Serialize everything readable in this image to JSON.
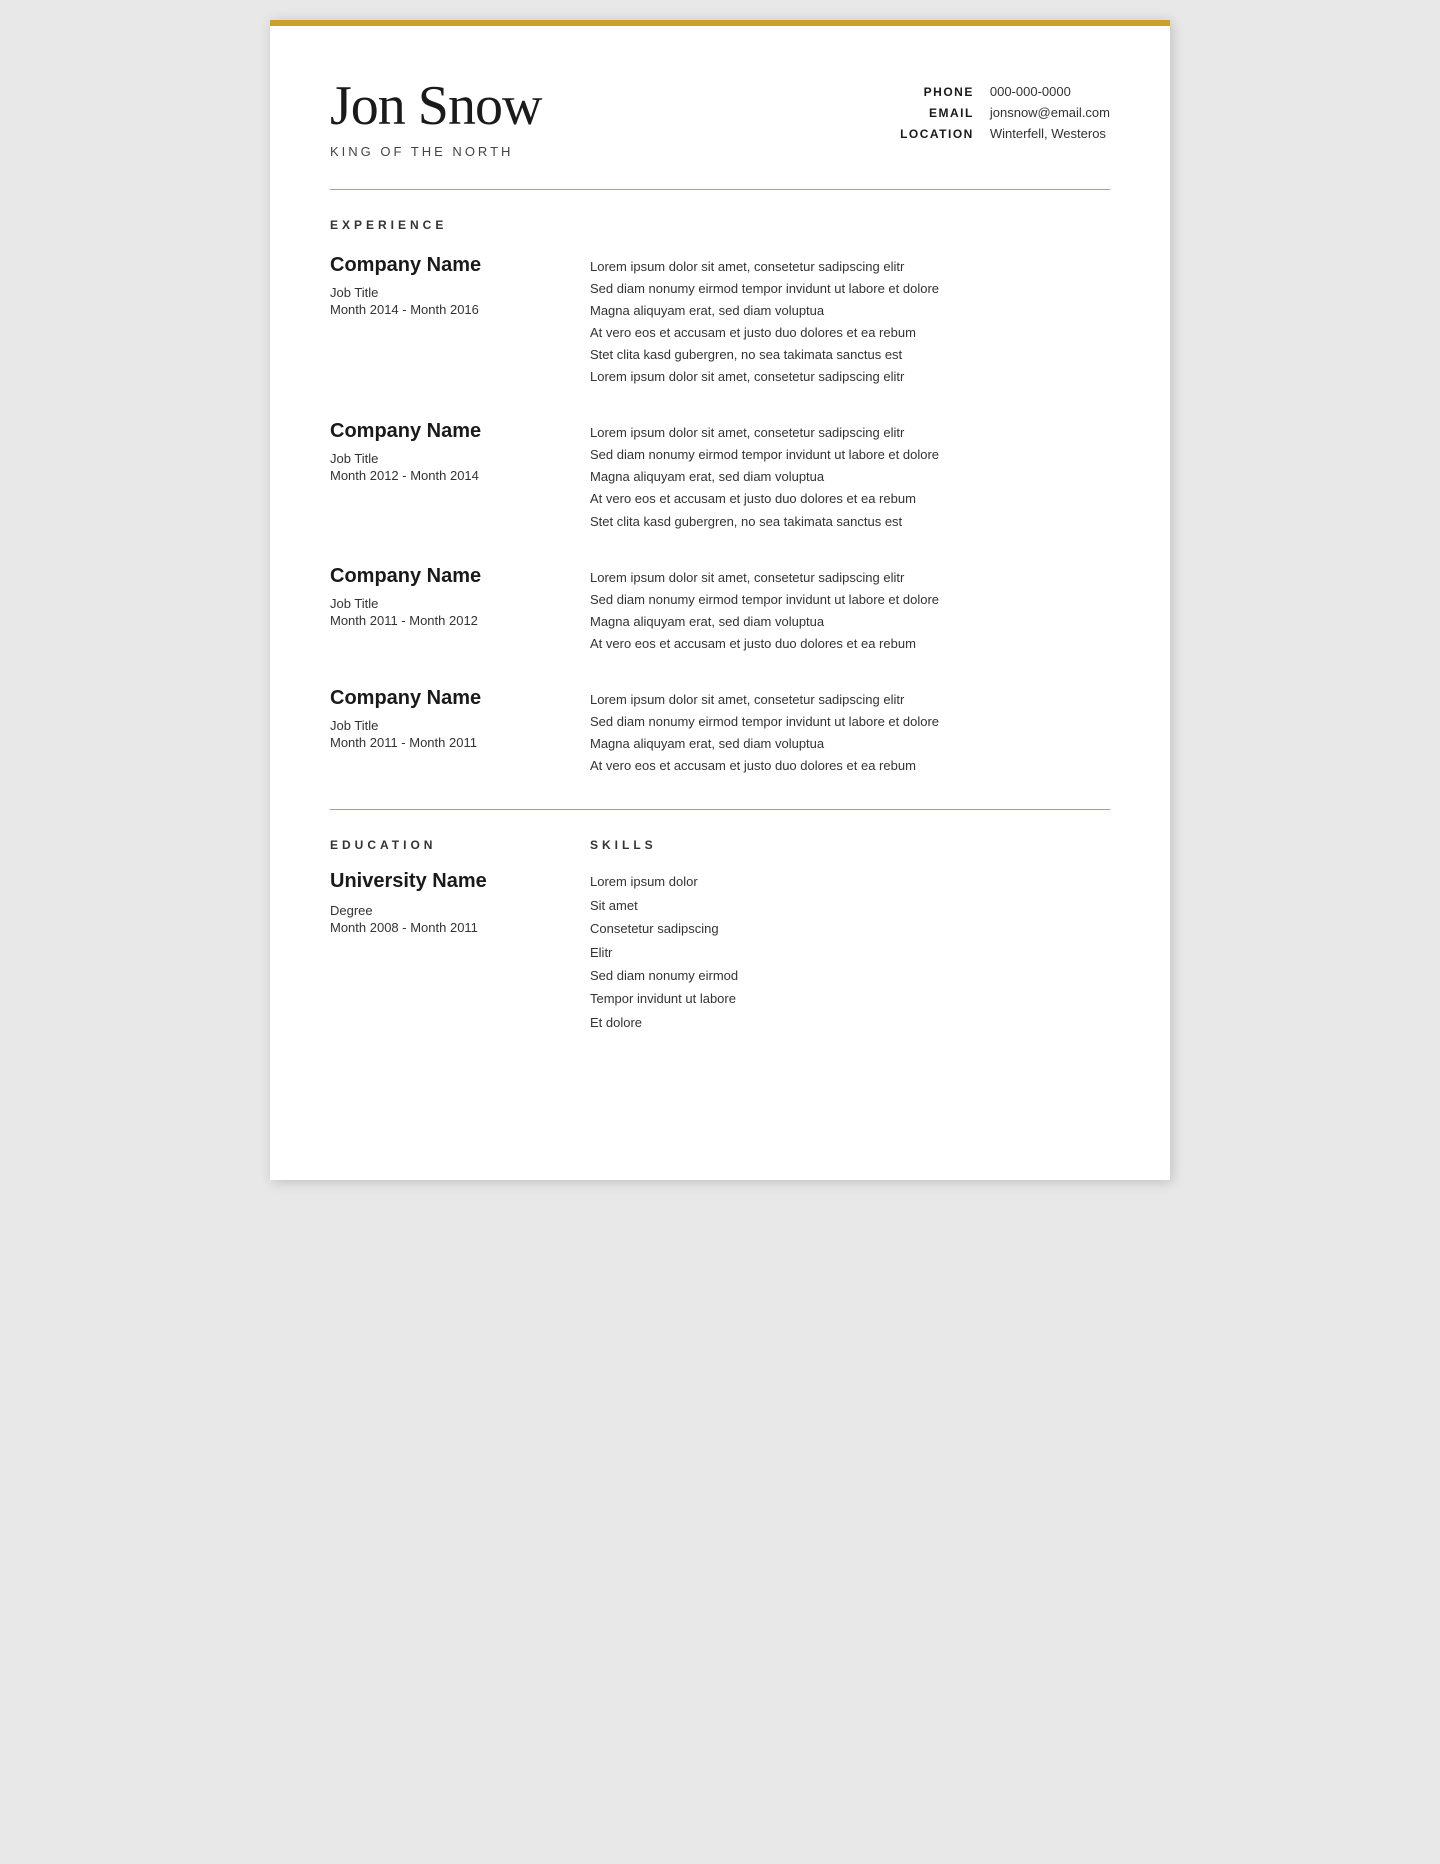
{
  "header": {
    "name": "Jon Snow",
    "tagline": "KING OF THE NORTH",
    "contact": {
      "phone_label": "PHONE",
      "phone_value": "000-000-0000",
      "email_label": "EMAIL",
      "email_value": "jonsnow@email.com",
      "location_label": "LOCATION",
      "location_value": "Winterfell, Westeros"
    }
  },
  "sections": {
    "experience_label": "EXPERIENCE",
    "education_label": "EDUCATION",
    "skills_label": "SKILLS"
  },
  "experience": [
    {
      "company": "Company Name",
      "title": "Job Title",
      "dates": "Month 2014 - Month 2016",
      "description": [
        "Lorem ipsum dolor sit amet, consetetur sadipscing elitr",
        "Sed diam nonumy eirmod tempor invidunt ut labore et dolore",
        "Magna aliquyam erat, sed diam voluptua",
        "At vero eos et accusam et justo duo dolores et ea rebum",
        "Stet clita kasd gubergren, no sea takimata sanctus est",
        "Lorem ipsum dolor sit amet, consetetur sadipscing elitr"
      ]
    },
    {
      "company": "Company Name",
      "title": "Job Title",
      "dates": "Month 2012 - Month 2014",
      "description": [
        "Lorem ipsum dolor sit amet, consetetur sadipscing elitr",
        "Sed diam nonumy eirmod tempor invidunt ut labore et dolore",
        "Magna aliquyam erat, sed diam voluptua",
        "At vero eos et accusam et justo duo dolores et ea rebum",
        "Stet clita kasd gubergren, no sea takimata sanctus est"
      ]
    },
    {
      "company": "Company Name",
      "title": "Job Title",
      "dates": "Month 2011 - Month 2012",
      "description": [
        "Lorem ipsum dolor sit amet, consetetur sadipscing elitr",
        "Sed diam nonumy eirmod tempor invidunt ut labore et dolore",
        "Magna aliquyam erat, sed diam voluptua",
        "At vero eos et accusam et justo duo dolores et ea rebum"
      ]
    },
    {
      "company": "Company Name",
      "title": "Job Title",
      "dates": "Month 2011 - Month 2011",
      "description": [
        "Lorem ipsum dolor sit amet, consetetur sadipscing elitr",
        "Sed diam nonumy eirmod tempor invidunt ut labore et dolore",
        "Magna aliquyam erat, sed diam voluptua",
        "At vero eos et accusam et justo duo dolores et ea rebum"
      ]
    }
  ],
  "education": {
    "university": "University Name",
    "degree": "Degree",
    "dates": "Month 2008 - Month 2011"
  },
  "skills": [
    "Lorem ipsum dolor",
    "Sit amet",
    "Consetetur sadipscing",
    "Elitr",
    "Sed diam nonumy eirmod",
    "Tempor invidunt ut labore",
    "Et dolore"
  ],
  "colors": {
    "accent": "#c9a227",
    "text_dark": "#1a1a1a",
    "text_medium": "#333333"
  }
}
